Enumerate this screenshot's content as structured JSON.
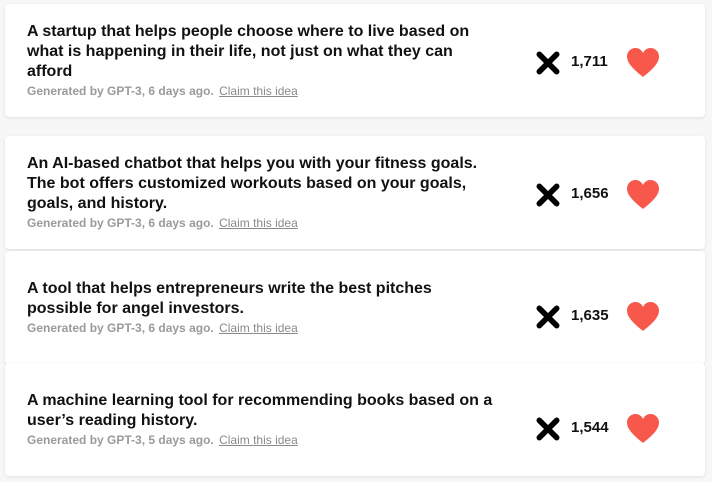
{
  "colors": {
    "heart": "#f8574b",
    "text": "#111111",
    "meta": "#9a9a9a",
    "card_bg": "#ffffff",
    "page_bg": "#f7f7f7"
  },
  "ideas": [
    {
      "title": "A startup that helps people choose where to live based on what is happening in their life, not just on what they can afford",
      "generated_by": "Generated by GPT-3, 6 days ago.",
      "claim_label": "Claim this idea",
      "votes": "1,711",
      "dismiss_icon": "close-icon",
      "like_icon": "heart-icon"
    },
    {
      "title": "An AI-based chatbot that helps you with your fitness goals. The bot offers customized workouts based on your goals, goals, and history.",
      "generated_by": "Generated by GPT-3, 6 days ago.",
      "claim_label": "Claim this idea",
      "votes": "1,656",
      "dismiss_icon": "close-icon",
      "like_icon": "heart-icon"
    },
    {
      "title": "A tool that helps entrepreneurs write the best pitches possible for angel investors.",
      "generated_by": "Generated by GPT-3, 6 days ago.",
      "claim_label": "Claim this idea",
      "votes": "1,635",
      "dismiss_icon": "close-icon",
      "like_icon": "heart-icon"
    },
    {
      "title": "A machine learning tool for recommending books based on a user’s reading history.",
      "generated_by": "Generated by GPT-3, 5 days ago.",
      "claim_label": "Claim this idea",
      "votes": "1,544",
      "dismiss_icon": "close-icon",
      "like_icon": "heart-icon"
    }
  ]
}
